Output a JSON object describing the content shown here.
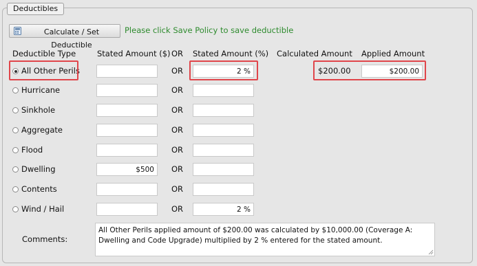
{
  "section": {
    "title": "Deductibles"
  },
  "toolbar": {
    "calculate_label": "Calculate / Set Deductible",
    "calculate_icon": "calculator-icon",
    "save_note": "Please click Save Policy to save deductible",
    "save_note_color": "#2e8b2e"
  },
  "headers": {
    "deductible_type": "Deductible Type",
    "stated_amount_dollar": "Stated Amount ($)",
    "or": "OR",
    "stated_amount_percent": "Stated Amount (%)",
    "calculated_amount": "Calculated Amount",
    "applied_amount": "Applied Amount"
  },
  "rows": [
    {
      "label": "All Other Perils",
      "selected": true,
      "stated_dollar": "",
      "or": "OR",
      "stated_percent": "2 %",
      "calculated": "$200.00",
      "applied": "$200.00"
    },
    {
      "label": "Hurricane",
      "selected": false,
      "stated_dollar": "",
      "or": "OR",
      "stated_percent": ""
    },
    {
      "label": "Sinkhole",
      "selected": false,
      "stated_dollar": "",
      "or": "OR",
      "stated_percent": ""
    },
    {
      "label": "Aggregate",
      "selected": false,
      "stated_dollar": "",
      "or": "OR",
      "stated_percent": ""
    },
    {
      "label": "Flood",
      "selected": false,
      "stated_dollar": "",
      "or": "OR",
      "stated_percent": ""
    },
    {
      "label": "Dwelling",
      "selected": false,
      "stated_dollar": "$500",
      "or": "OR",
      "stated_percent": ""
    },
    {
      "label": "Contents",
      "selected": false,
      "stated_dollar": "",
      "or": "OR",
      "stated_percent": ""
    },
    {
      "label": "Wind / Hail",
      "selected": false,
      "stated_dollar": "",
      "or": "OR",
      "stated_percent": "2 %"
    }
  ],
  "comments": {
    "label": "Comments:",
    "value": "All Other Perils applied amount of $200.00 was calculated by $10,000.00 (Coverage A: Dwelling and Code Upgrade) multiplied by 2 % entered for the stated amount."
  },
  "highlight_color": "#e0454a"
}
